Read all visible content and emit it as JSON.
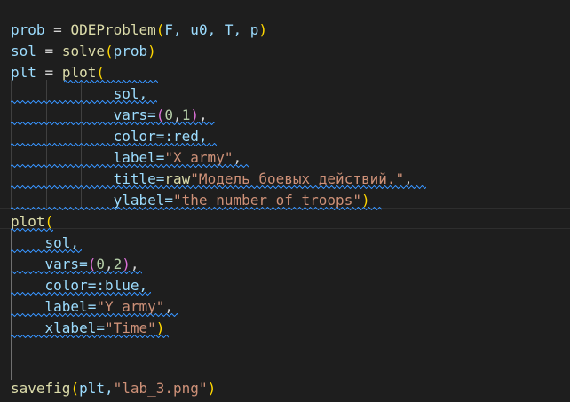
{
  "code": {
    "l1": {
      "v": "prob",
      "eq": " = ",
      "fn": "ODEProblem",
      "po": "(",
      "args": "F, u0, T, p",
      "pc": ")"
    },
    "l2": {
      "v": "sol",
      "eq": " = ",
      "fn": "solve",
      "po": "(",
      "args": "prob",
      "pc": ")"
    },
    "l3": {
      "v": "plt",
      "eq": " = ",
      "fn": "plot",
      "po": "("
    },
    "l4": {
      "ind": "            ",
      "t": "sol,"
    },
    "l5": {
      "ind": "            ",
      "k": "vars=",
      "po": "(",
      "a": "0",
      "c": ",",
      "b": "1",
      "pc": ")",
      "tail": ","
    },
    "l6": {
      "ind": "            ",
      "t": "color=:red,"
    },
    "l7": {
      "ind": "            ",
      "k": "label=",
      "s": "\"X army\"",
      "tail": ","
    },
    "l8": {
      "ind": "            ",
      "k": "title=",
      "raw": "raw",
      "s": "\"Модель боевых действий.\"",
      "tail": ","
    },
    "l9": {
      "ind": "            ",
      "k": "ylabel=",
      "s": "\"the number of troops\"",
      "pc": ")"
    },
    "l10": {
      "fn": "plot",
      "po": "("
    },
    "l11": {
      "ind": "    ",
      "t": "sol,"
    },
    "l12": {
      "ind": "    ",
      "k": "vars=",
      "po": "(",
      "a": "0",
      "c": ",",
      "b": "2",
      "pc": ")",
      "tail": ","
    },
    "l13": {
      "ind": "    ",
      "t": "color=:blue,"
    },
    "l14": {
      "ind": "    ",
      "k": "label=",
      "s": "\"Y army\"",
      "tail": ","
    },
    "l15": {
      "ind": "    ",
      "k": "xlabel=",
      "s": "\"Time\"",
      "pc": ")"
    },
    "l18": {
      "fn": "savefig",
      "po": "(",
      "args": "plt,",
      "s": "\"lab_3.png\"",
      "pc": ")"
    }
  },
  "colors": {
    "background": "#1e1e1e",
    "variable": "#9cdcfe",
    "function": "#dcdcaa",
    "string": "#ce9178",
    "number": "#b5cea8",
    "bracket_level1": "#ffd700",
    "bracket_level2": "#da70d6",
    "squiggle": "#3794ff"
  }
}
